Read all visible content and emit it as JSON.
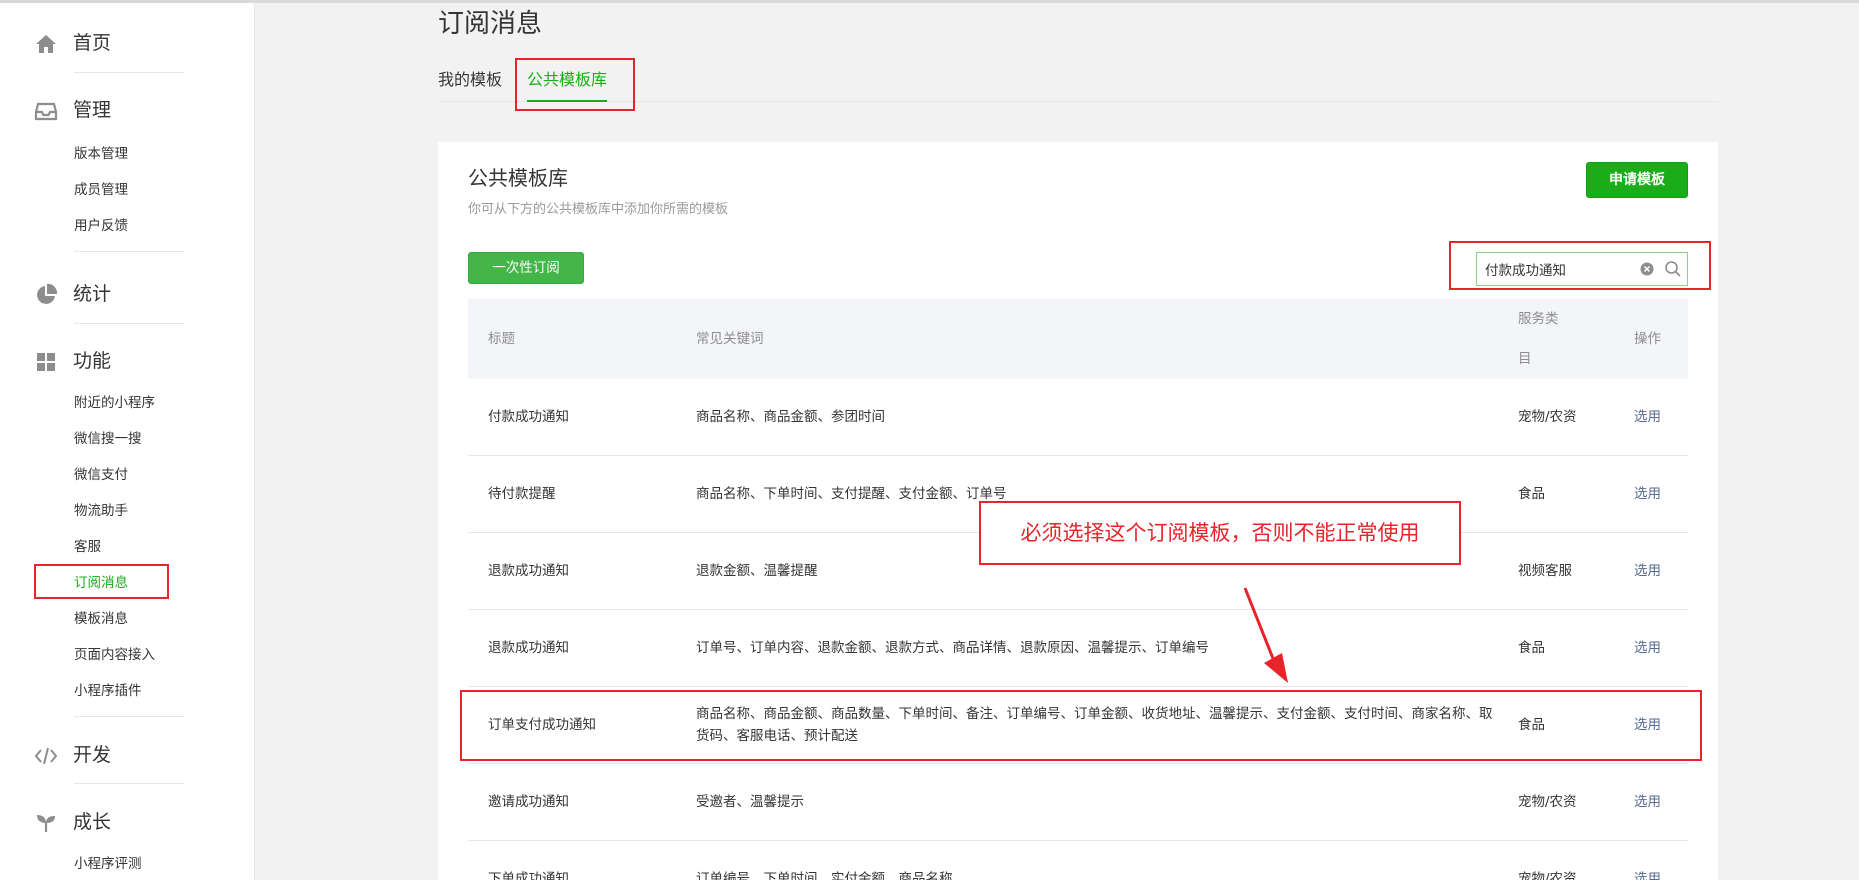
{
  "sidebar": {
    "home_label": "首页",
    "manage_label": "管理",
    "manage_items": [
      "版本管理",
      "成员管理",
      "用户反馈"
    ],
    "stats_label": "统计",
    "features_label": "功能",
    "feature_items": [
      "附近的小程序",
      "微信搜一搜",
      "微信支付",
      "物流助手",
      "客服",
      "订阅消息",
      "模板消息",
      "页面内容接入",
      "小程序插件"
    ],
    "dev_label": "开发",
    "growth_label": "成长",
    "growth_items": [
      "小程序评测"
    ]
  },
  "page": {
    "title": "订阅消息",
    "tabs": [
      "我的模板",
      "公共模板库"
    ]
  },
  "panel": {
    "title": "公共模板库",
    "description": "你可从下方的公共模板库中添加你所需的模板",
    "apply_button": "申请模板",
    "once_button": "一次性订阅",
    "search_value": "付款成功通知"
  },
  "table": {
    "headers": {
      "title": "标题",
      "keywords": "常见关键词",
      "service_line1": "服务类",
      "service_line2": "目",
      "action": "操作"
    },
    "rows": [
      {
        "title": "付款成功通知",
        "keywords": "商品名称、商品金额、参团时间",
        "service": "宠物/农资",
        "action": "选用"
      },
      {
        "title": "待付款提醒",
        "keywords": "商品名称、下单时间、支付提醒、支付金额、订单号",
        "service": "食品",
        "action": "选用"
      },
      {
        "title": "退款成功通知",
        "keywords": "退款金额、温馨提醒",
        "service": "视频客服",
        "action": "选用"
      },
      {
        "title": "退款成功通知",
        "keywords": "订单号、订单内容、退款金额、退款方式、商品详情、退款原因、温馨提示、订单编号",
        "service": "食品",
        "action": "选用"
      },
      {
        "title": "订单支付成功通知",
        "keywords": "商品名称、商品金额、商品数量、下单时间、备注、订单编号、订单金额、收货地址、温馨提示、支付金额、支付时间、商家名称、取货码、客服电话、预计配送",
        "service": "食品",
        "action": "选用"
      },
      {
        "title": "邀请成功通知",
        "keywords": "受邀者、温馨提示",
        "service": "宠物/农资",
        "action": "选用"
      },
      {
        "title": "下单成功通知",
        "keywords": "订单编号、下单时间、实付金额、商品名称",
        "service": "宠物/农资",
        "action": "选用"
      }
    ]
  },
  "annotation": {
    "callout_text": "必须选择这个订阅模板，否则不能正常使用",
    "color": "#e8232a"
  },
  "colors": {
    "accent": "#1aad19",
    "link": "#576b95"
  },
  "icons": [
    "home-icon",
    "inbox-icon",
    "pie-chart-icon",
    "grid-icon",
    "code-icon",
    "sprout-icon",
    "clear-icon",
    "search-icon"
  ]
}
